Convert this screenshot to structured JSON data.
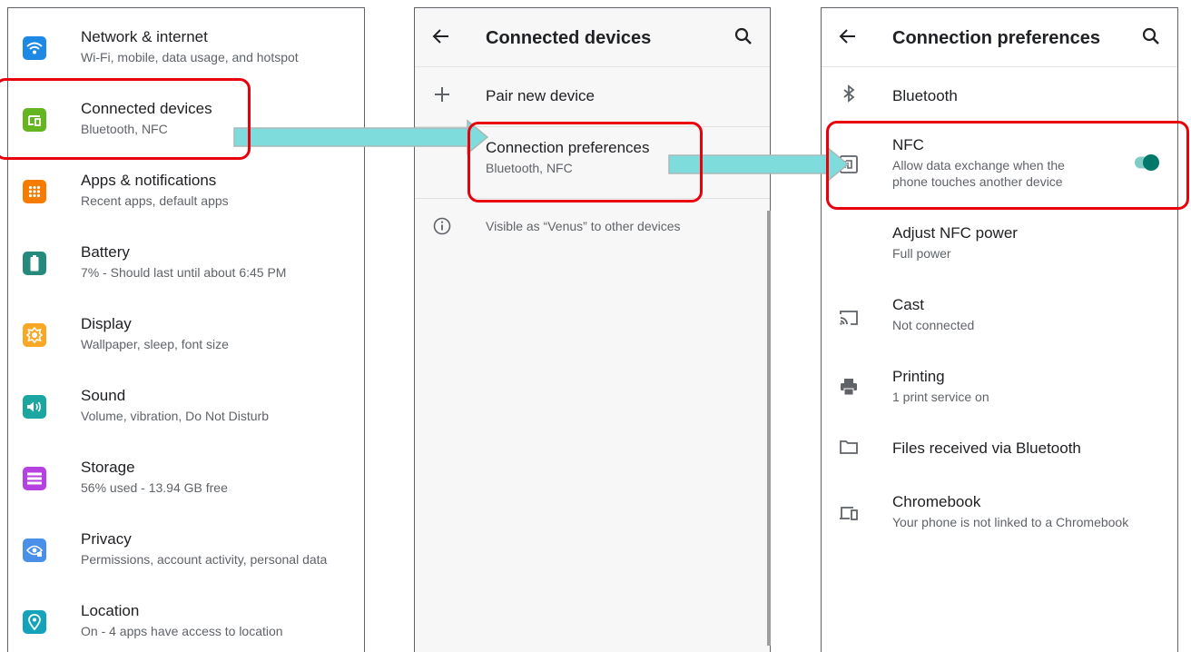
{
  "settings": {
    "items": [
      {
        "title": "Network & internet",
        "subtitle": "Wi-Fi, mobile, data usage, and hotspot",
        "icon": "wifi-icon",
        "color": "#1e88e5"
      },
      {
        "title": "Connected devices",
        "subtitle": "Bluetooth, NFC",
        "icon": "devices-icon",
        "color": "#64b51f"
      },
      {
        "title": "Apps & notifications",
        "subtitle": "Recent apps, default apps",
        "icon": "apps-grid-icon",
        "color": "#f57c00"
      },
      {
        "title": "Battery",
        "subtitle": "7% - Should last until about 6:45 PM",
        "icon": "battery-icon",
        "color": "#26897b"
      },
      {
        "title": "Display",
        "subtitle": "Wallpaper, sleep, font size",
        "icon": "brightness-icon",
        "color": "#f9a825"
      },
      {
        "title": "Sound",
        "subtitle": "Volume, vibration, Do Not Disturb",
        "icon": "volume-icon",
        "color": "#1ba6a0"
      },
      {
        "title": "Storage",
        "subtitle": "56% used - 13.94 GB free",
        "icon": "storage-icon",
        "color": "#b542e0"
      },
      {
        "title": "Privacy",
        "subtitle": "Permissions, account activity, personal data",
        "icon": "privacy-eye-icon",
        "color": "#4a8fe8"
      },
      {
        "title": "Location",
        "subtitle": "On - 4 apps have access to location",
        "icon": "location-pin-icon",
        "color": "#14a3b8"
      }
    ]
  },
  "connected": {
    "title": "Connected devices",
    "pair_label": "Pair new device",
    "prefs_title": "Connection preferences",
    "prefs_subtitle": "Bluetooth, NFC",
    "visible_text": "Visible as “Venus” to other devices"
  },
  "prefs": {
    "title": "Connection preferences",
    "bluetooth_label": "Bluetooth",
    "nfc_title": "NFC",
    "nfc_subtitle_1": "Allow data exchange when the",
    "nfc_subtitle_2": "phone touches another device",
    "nfc_enabled": true,
    "adjust_title": "Adjust NFC power",
    "adjust_subtitle": "Full power",
    "cast_title": "Cast",
    "cast_subtitle": "Not connected",
    "printing_title": "Printing",
    "printing_subtitle": "1 print service on",
    "files_label": "Files received via Bluetooth",
    "chromebook_title": "Chromebook",
    "chromebook_subtitle": "Your phone is not linked to a Chromebook"
  },
  "colors": {
    "callout": "#e8000b",
    "arrow": "#7fdcdc",
    "toggle_on": "#00796b"
  }
}
